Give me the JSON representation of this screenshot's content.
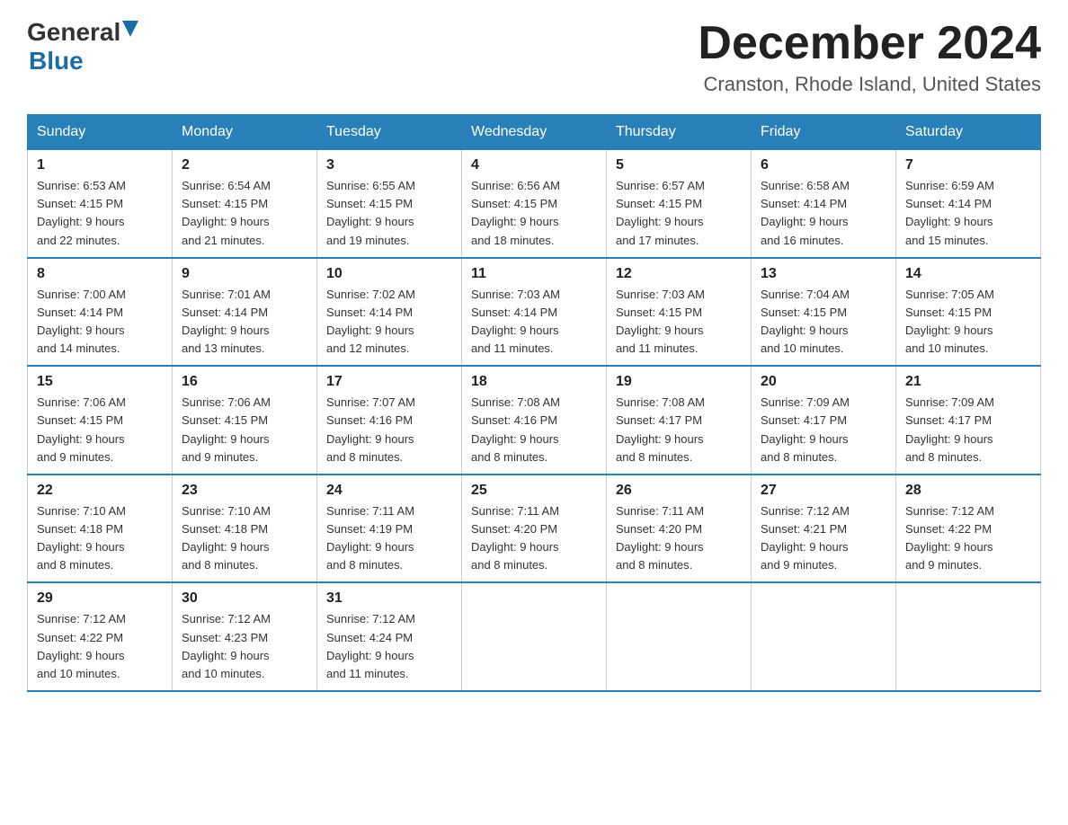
{
  "header": {
    "logo_general": "General",
    "logo_blue": "Blue",
    "month_title": "December 2024",
    "location": "Cranston, Rhode Island, United States"
  },
  "days_of_week": [
    "Sunday",
    "Monday",
    "Tuesday",
    "Wednesday",
    "Thursday",
    "Friday",
    "Saturday"
  ],
  "weeks": [
    [
      {
        "day": "1",
        "sunrise": "6:53 AM",
        "sunset": "4:15 PM",
        "daylight": "9 hours and 22 minutes."
      },
      {
        "day": "2",
        "sunrise": "6:54 AM",
        "sunset": "4:15 PM",
        "daylight": "9 hours and 21 minutes."
      },
      {
        "day": "3",
        "sunrise": "6:55 AM",
        "sunset": "4:15 PM",
        "daylight": "9 hours and 19 minutes."
      },
      {
        "day": "4",
        "sunrise": "6:56 AM",
        "sunset": "4:15 PM",
        "daylight": "9 hours and 18 minutes."
      },
      {
        "day": "5",
        "sunrise": "6:57 AM",
        "sunset": "4:15 PM",
        "daylight": "9 hours and 17 minutes."
      },
      {
        "day": "6",
        "sunrise": "6:58 AM",
        "sunset": "4:14 PM",
        "daylight": "9 hours and 16 minutes."
      },
      {
        "day": "7",
        "sunrise": "6:59 AM",
        "sunset": "4:14 PM",
        "daylight": "9 hours and 15 minutes."
      }
    ],
    [
      {
        "day": "8",
        "sunrise": "7:00 AM",
        "sunset": "4:14 PM",
        "daylight": "9 hours and 14 minutes."
      },
      {
        "day": "9",
        "sunrise": "7:01 AM",
        "sunset": "4:14 PM",
        "daylight": "9 hours and 13 minutes."
      },
      {
        "day": "10",
        "sunrise": "7:02 AM",
        "sunset": "4:14 PM",
        "daylight": "9 hours and 12 minutes."
      },
      {
        "day": "11",
        "sunrise": "7:03 AM",
        "sunset": "4:14 PM",
        "daylight": "9 hours and 11 minutes."
      },
      {
        "day": "12",
        "sunrise": "7:03 AM",
        "sunset": "4:15 PM",
        "daylight": "9 hours and 11 minutes."
      },
      {
        "day": "13",
        "sunrise": "7:04 AM",
        "sunset": "4:15 PM",
        "daylight": "9 hours and 10 minutes."
      },
      {
        "day": "14",
        "sunrise": "7:05 AM",
        "sunset": "4:15 PM",
        "daylight": "9 hours and 10 minutes."
      }
    ],
    [
      {
        "day": "15",
        "sunrise": "7:06 AM",
        "sunset": "4:15 PM",
        "daylight": "9 hours and 9 minutes."
      },
      {
        "day": "16",
        "sunrise": "7:06 AM",
        "sunset": "4:15 PM",
        "daylight": "9 hours and 9 minutes."
      },
      {
        "day": "17",
        "sunrise": "7:07 AM",
        "sunset": "4:16 PM",
        "daylight": "9 hours and 8 minutes."
      },
      {
        "day": "18",
        "sunrise": "7:08 AM",
        "sunset": "4:16 PM",
        "daylight": "9 hours and 8 minutes."
      },
      {
        "day": "19",
        "sunrise": "7:08 AM",
        "sunset": "4:17 PM",
        "daylight": "9 hours and 8 minutes."
      },
      {
        "day": "20",
        "sunrise": "7:09 AM",
        "sunset": "4:17 PM",
        "daylight": "9 hours and 8 minutes."
      },
      {
        "day": "21",
        "sunrise": "7:09 AM",
        "sunset": "4:17 PM",
        "daylight": "9 hours and 8 minutes."
      }
    ],
    [
      {
        "day": "22",
        "sunrise": "7:10 AM",
        "sunset": "4:18 PM",
        "daylight": "9 hours and 8 minutes."
      },
      {
        "day": "23",
        "sunrise": "7:10 AM",
        "sunset": "4:18 PM",
        "daylight": "9 hours and 8 minutes."
      },
      {
        "day": "24",
        "sunrise": "7:11 AM",
        "sunset": "4:19 PM",
        "daylight": "9 hours and 8 minutes."
      },
      {
        "day": "25",
        "sunrise": "7:11 AM",
        "sunset": "4:20 PM",
        "daylight": "9 hours and 8 minutes."
      },
      {
        "day": "26",
        "sunrise": "7:11 AM",
        "sunset": "4:20 PM",
        "daylight": "9 hours and 8 minutes."
      },
      {
        "day": "27",
        "sunrise": "7:12 AM",
        "sunset": "4:21 PM",
        "daylight": "9 hours and 9 minutes."
      },
      {
        "day": "28",
        "sunrise": "7:12 AM",
        "sunset": "4:22 PM",
        "daylight": "9 hours and 9 minutes."
      }
    ],
    [
      {
        "day": "29",
        "sunrise": "7:12 AM",
        "sunset": "4:22 PM",
        "daylight": "9 hours and 10 minutes."
      },
      {
        "day": "30",
        "sunrise": "7:12 AM",
        "sunset": "4:23 PM",
        "daylight": "9 hours and 10 minutes."
      },
      {
        "day": "31",
        "sunrise": "7:12 AM",
        "sunset": "4:24 PM",
        "daylight": "9 hours and 11 minutes."
      },
      null,
      null,
      null,
      null
    ]
  ],
  "labels": {
    "sunrise": "Sunrise:",
    "sunset": "Sunset:",
    "daylight": "Daylight:"
  }
}
